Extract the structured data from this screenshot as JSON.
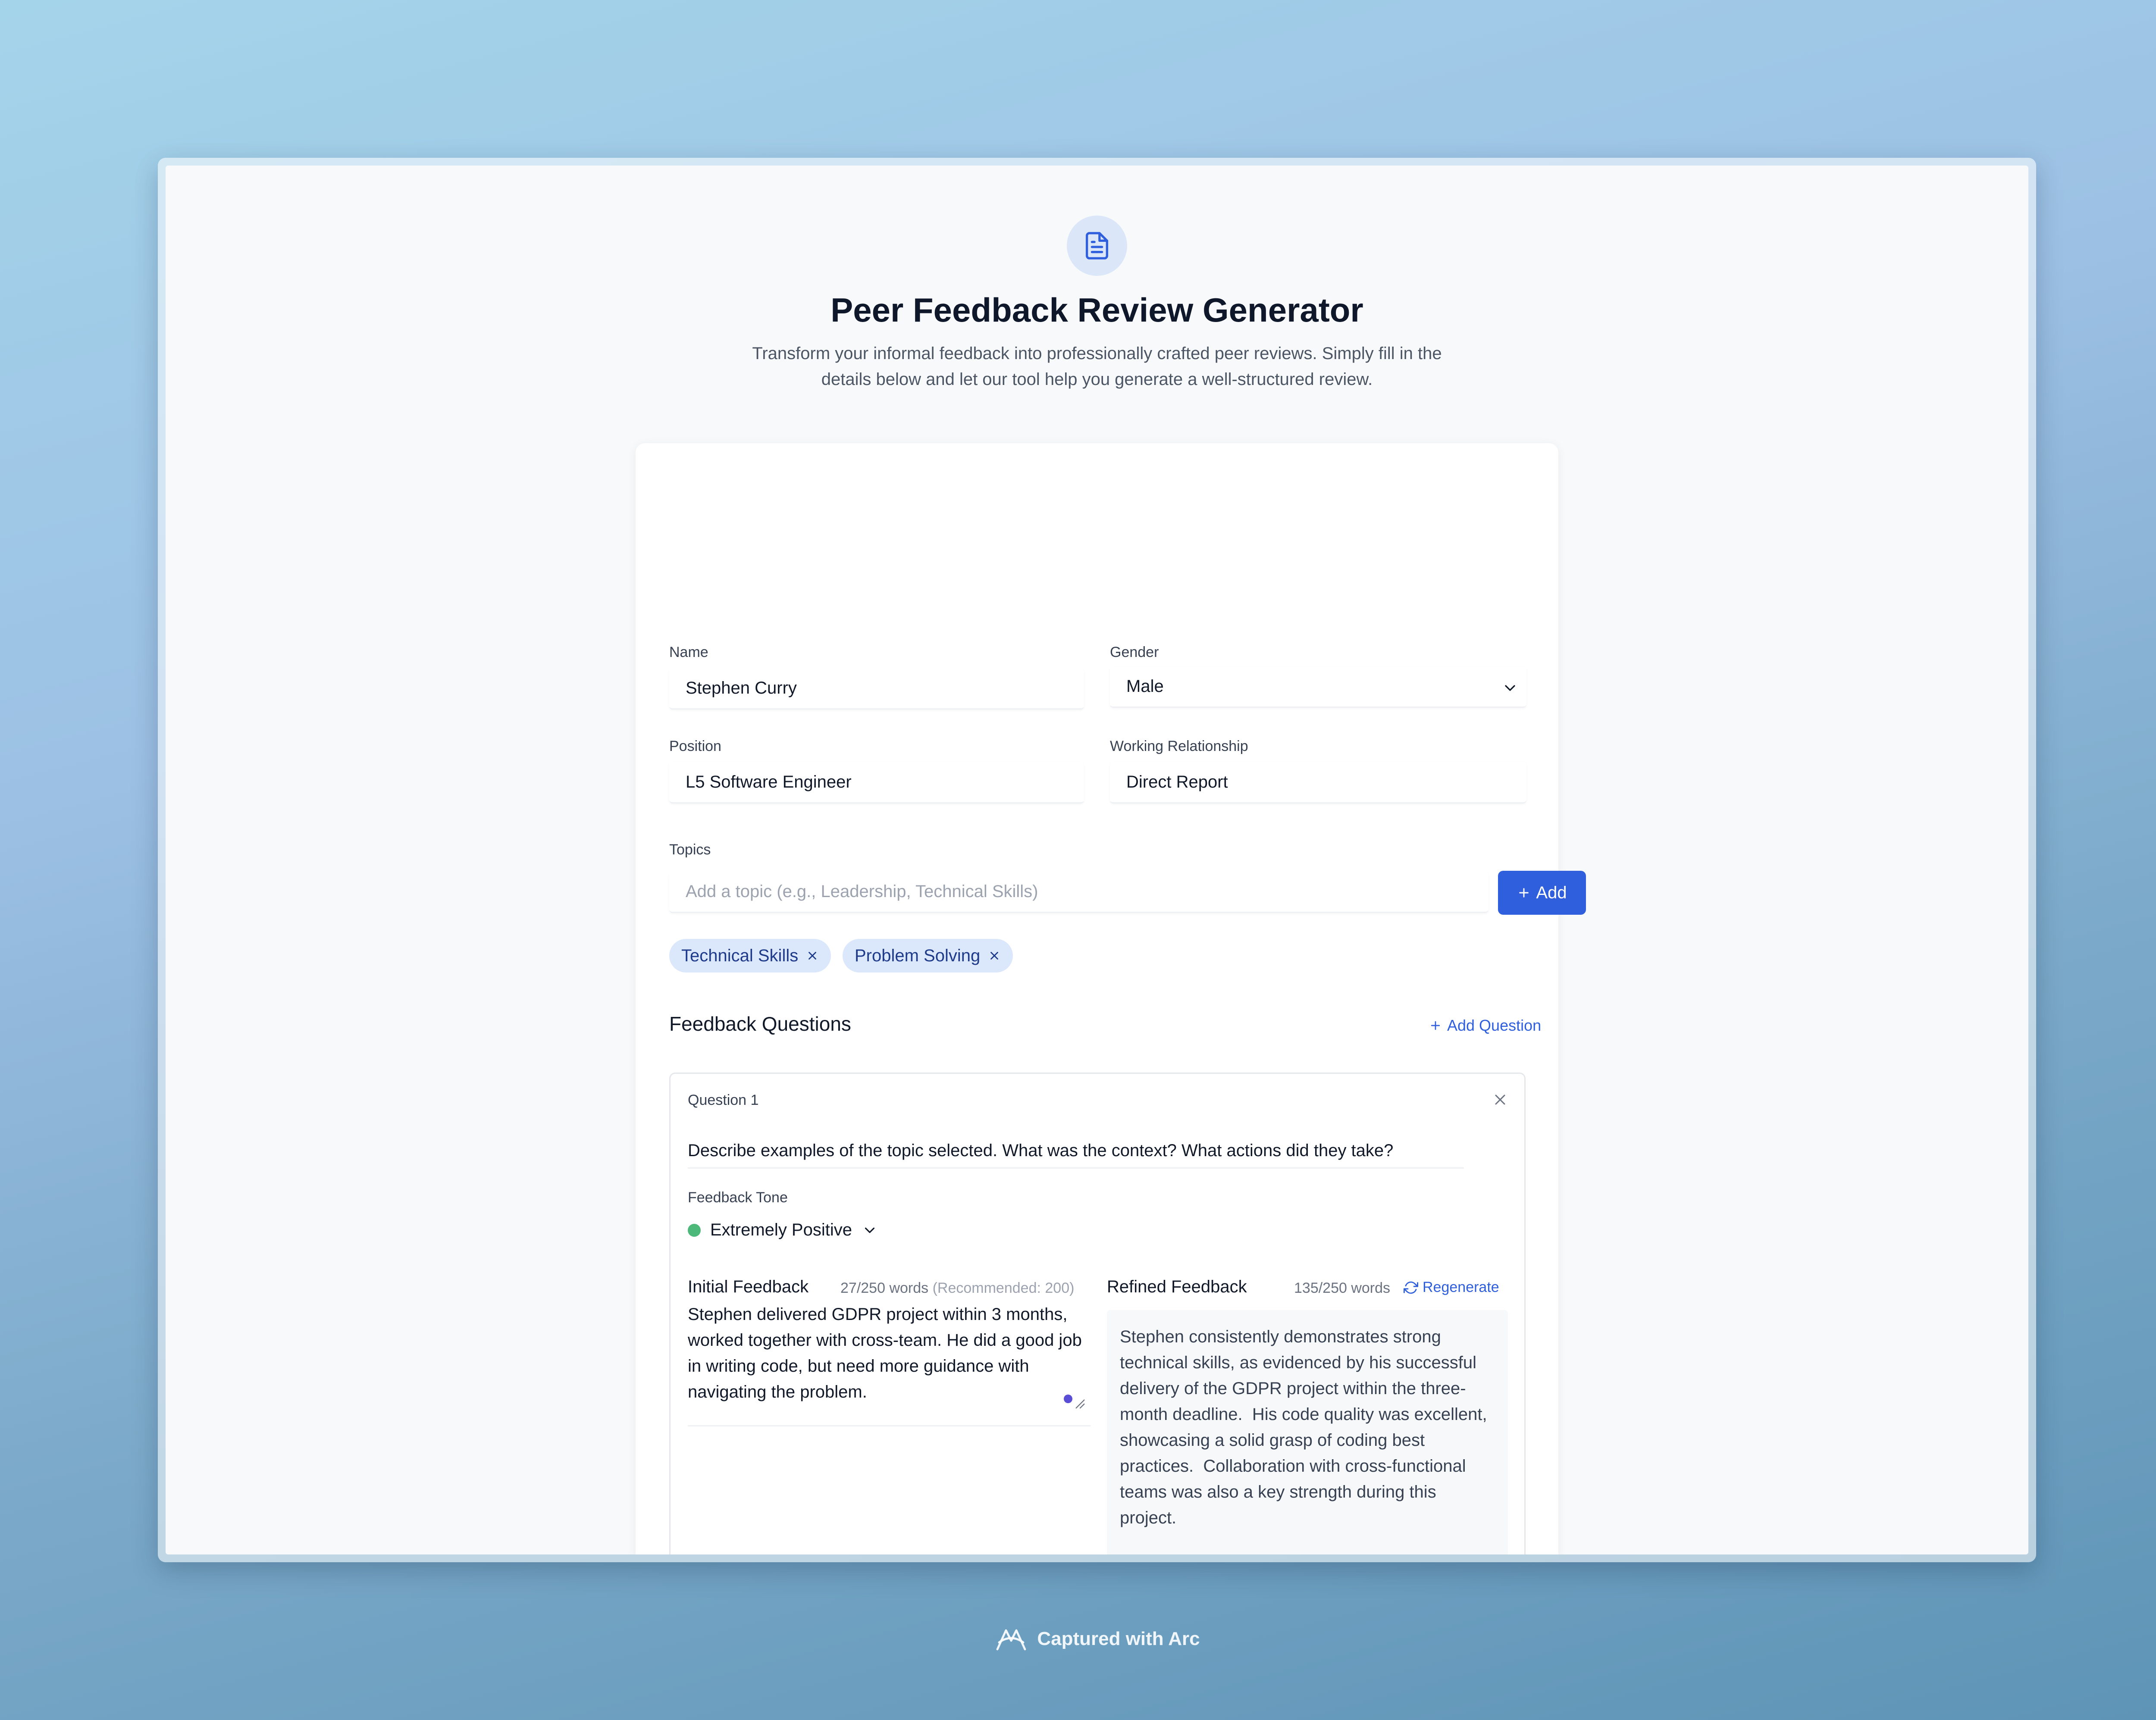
{
  "header": {
    "title": "Peer Feedback Review Generator",
    "subtitle": "Transform your informal feedback into professionally crafted peer reviews. Simply fill in the details below and let our tool help you generate a well-structured review.",
    "icon": "document-icon"
  },
  "form": {
    "name_label": "Name",
    "name_value": "Stephen Curry",
    "gender_label": "Gender",
    "gender_value": "Male",
    "position_label": "Position",
    "position_value": "L5 Software Engineer",
    "relationship_label": "Working Relationship",
    "relationship_value": "Direct Report",
    "topics_label": "Topics",
    "topic_placeholder": "Add a topic (e.g., Leadership, Technical Skills)",
    "add_label": "Add",
    "topics": [
      "Technical Skills",
      "Problem Solving"
    ]
  },
  "questions": {
    "section_title": "Feedback Questions",
    "add_question_label": "Add Question",
    "items": [
      {
        "title": "Question 1",
        "text": "Describe examples of the topic selected. What was the context? What actions did they take?",
        "tone_label": "Feedback Tone",
        "tone_value": "Extremely Positive",
        "tone_color": "#4cb87a",
        "initial_label": "Initial Feedback",
        "initial_count": "27/250 words",
        "initial_recommended": "(Recommended: 200)",
        "initial_text": "Stephen delivered GDPR project within 3 months, worked together with cross-team. He did a good job in writing code, but need more guidance with navigating the problem.",
        "refined_label": "Refined Feedback",
        "refined_count": "135/250 words",
        "regenerate_label": "Regenerate",
        "refined_text": "Stephen consistently demonstrates strong technical skills, as evidenced by his successful delivery of the GDPR project within the three-month deadline.  His code quality was excellent, showcasing a solid grasp of coding best practices.  Collaboration with cross-functional teams was also a key strength during this project.\n\nHowever, opportunities exist for growth in his problem-solving approach. While he ultimately completed the GDPR project successfully, he required more guidance in navigating complex challenges and defining the optimal solution path.  This suggests a need for increased proactive problem decomposition and solution"
      }
    ]
  },
  "footer": {
    "text": "Captured with Arc"
  },
  "colors": {
    "accent": "#2f5fdc",
    "chip_bg": "#dbe7fb",
    "chip_text": "#1e3a8a"
  }
}
